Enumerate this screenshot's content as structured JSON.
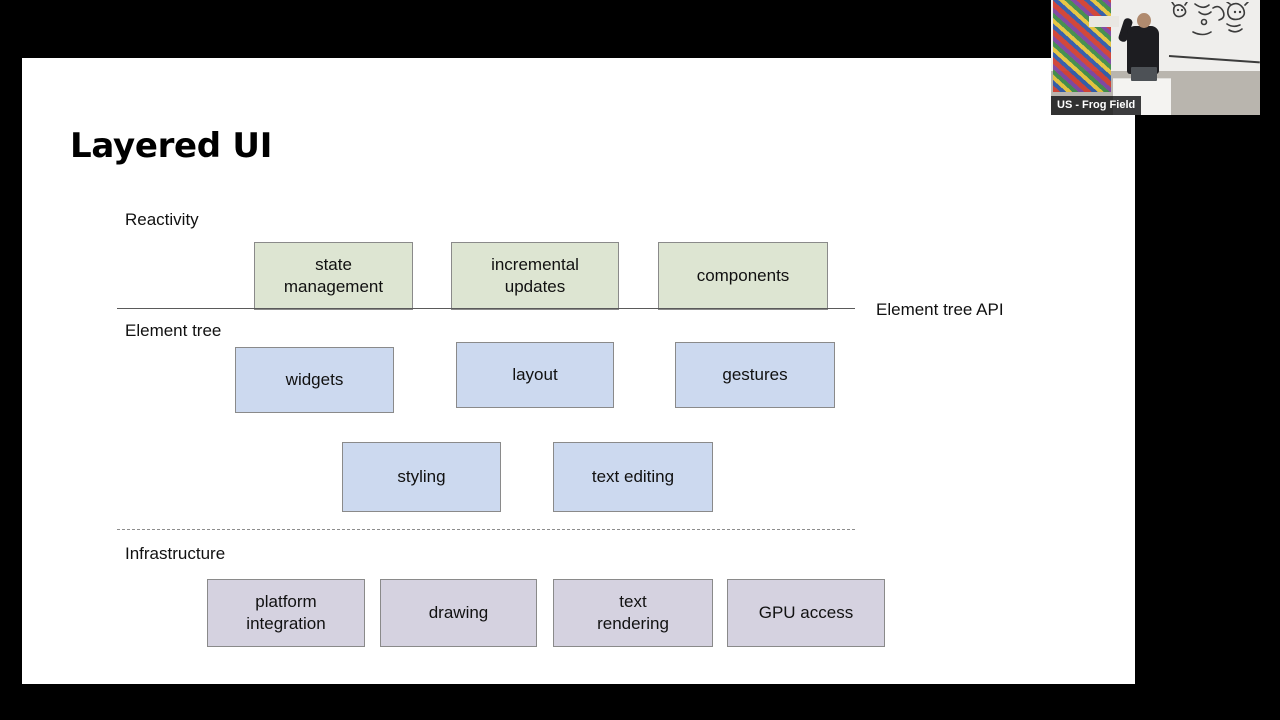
{
  "slide": {
    "title": "Layered UI",
    "labels": {
      "reactivity": "Reactivity",
      "element_tree": "Element tree",
      "element_tree_api": "Element tree API",
      "infrastructure": "Infrastructure"
    },
    "rows": {
      "reactivity_boxes": [
        {
          "label": "state\nmanagement"
        },
        {
          "label": "incremental\nupdates"
        },
        {
          "label": "components"
        }
      ],
      "element_tree_boxes_row1": [
        {
          "label": "widgets"
        },
        {
          "label": "layout"
        },
        {
          "label": "gestures"
        }
      ],
      "element_tree_boxes_row2": [
        {
          "label": "styling"
        },
        {
          "label": "text editing"
        }
      ],
      "infrastructure_boxes": [
        {
          "label": "platform\nintegration"
        },
        {
          "label": "drawing"
        },
        {
          "label": "text\nrendering"
        },
        {
          "label": "GPU access"
        }
      ]
    },
    "colors": {
      "reactivity_fill": "#dde5d2",
      "element_tree_fill": "#ccd9ef",
      "infrastructure_fill": "#d5d2e0",
      "box_border": "#8a8a8a",
      "slide_background": "#ffffff",
      "screen_background": "#000000"
    }
  },
  "video": {
    "participant_name": "US - Frog Field"
  }
}
